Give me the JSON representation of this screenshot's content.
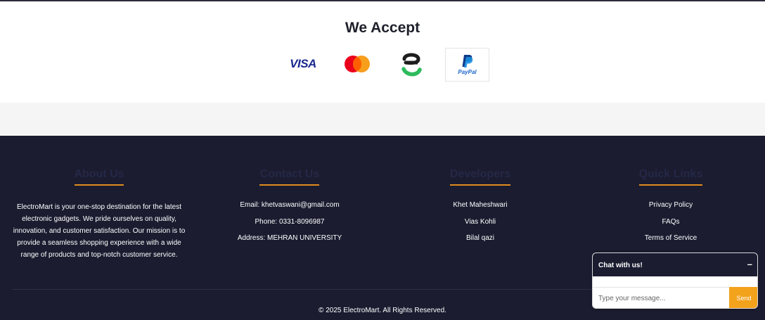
{
  "accept": {
    "title": "We Accept",
    "methods": [
      {
        "name": "VISA",
        "icon": "visa-icon"
      },
      {
        "name": "Mastercard",
        "icon": "mastercard-icon"
      },
      {
        "name": "Easypaisa",
        "icon": "easypaisa-icon"
      },
      {
        "name": "PayPal",
        "icon": "paypal-icon"
      }
    ],
    "visa_label": "VISA",
    "paypal_label": "PayPal"
  },
  "footer": {
    "about": {
      "title": "About Us",
      "text": "ElectroMart is your one-stop destination for the latest electronic gadgets. We pride ourselves on quality, innovation, and customer satisfaction. Our mission is to provide a seamless shopping experience with a wide range of products and top-notch customer service."
    },
    "contact": {
      "title": "Contact Us",
      "items": [
        "Email: khetvaswani@gmail.com",
        "Phone: 0331-8096987",
        "Address: MEHRAN UNIVERSITY"
      ]
    },
    "developers": {
      "title": "Developers",
      "items": [
        "Khet Maheshwari",
        "Vias Kohli",
        "Bilal qazi"
      ]
    },
    "quick_links": {
      "title": "Quick Links",
      "items": [
        "Privacy Policy",
        "FAQs",
        "Terms of Service"
      ]
    },
    "copyright": "© 2025 ElectroMart. All Rights Reserved."
  },
  "chat": {
    "title": "Chat with us!",
    "minimize": "–",
    "placeholder": "Type your message...",
    "send_label": "Send"
  },
  "colors": {
    "footer_bg": "#1b1c30",
    "accent": "#e08c1c",
    "send_button": "#f3a21c"
  }
}
